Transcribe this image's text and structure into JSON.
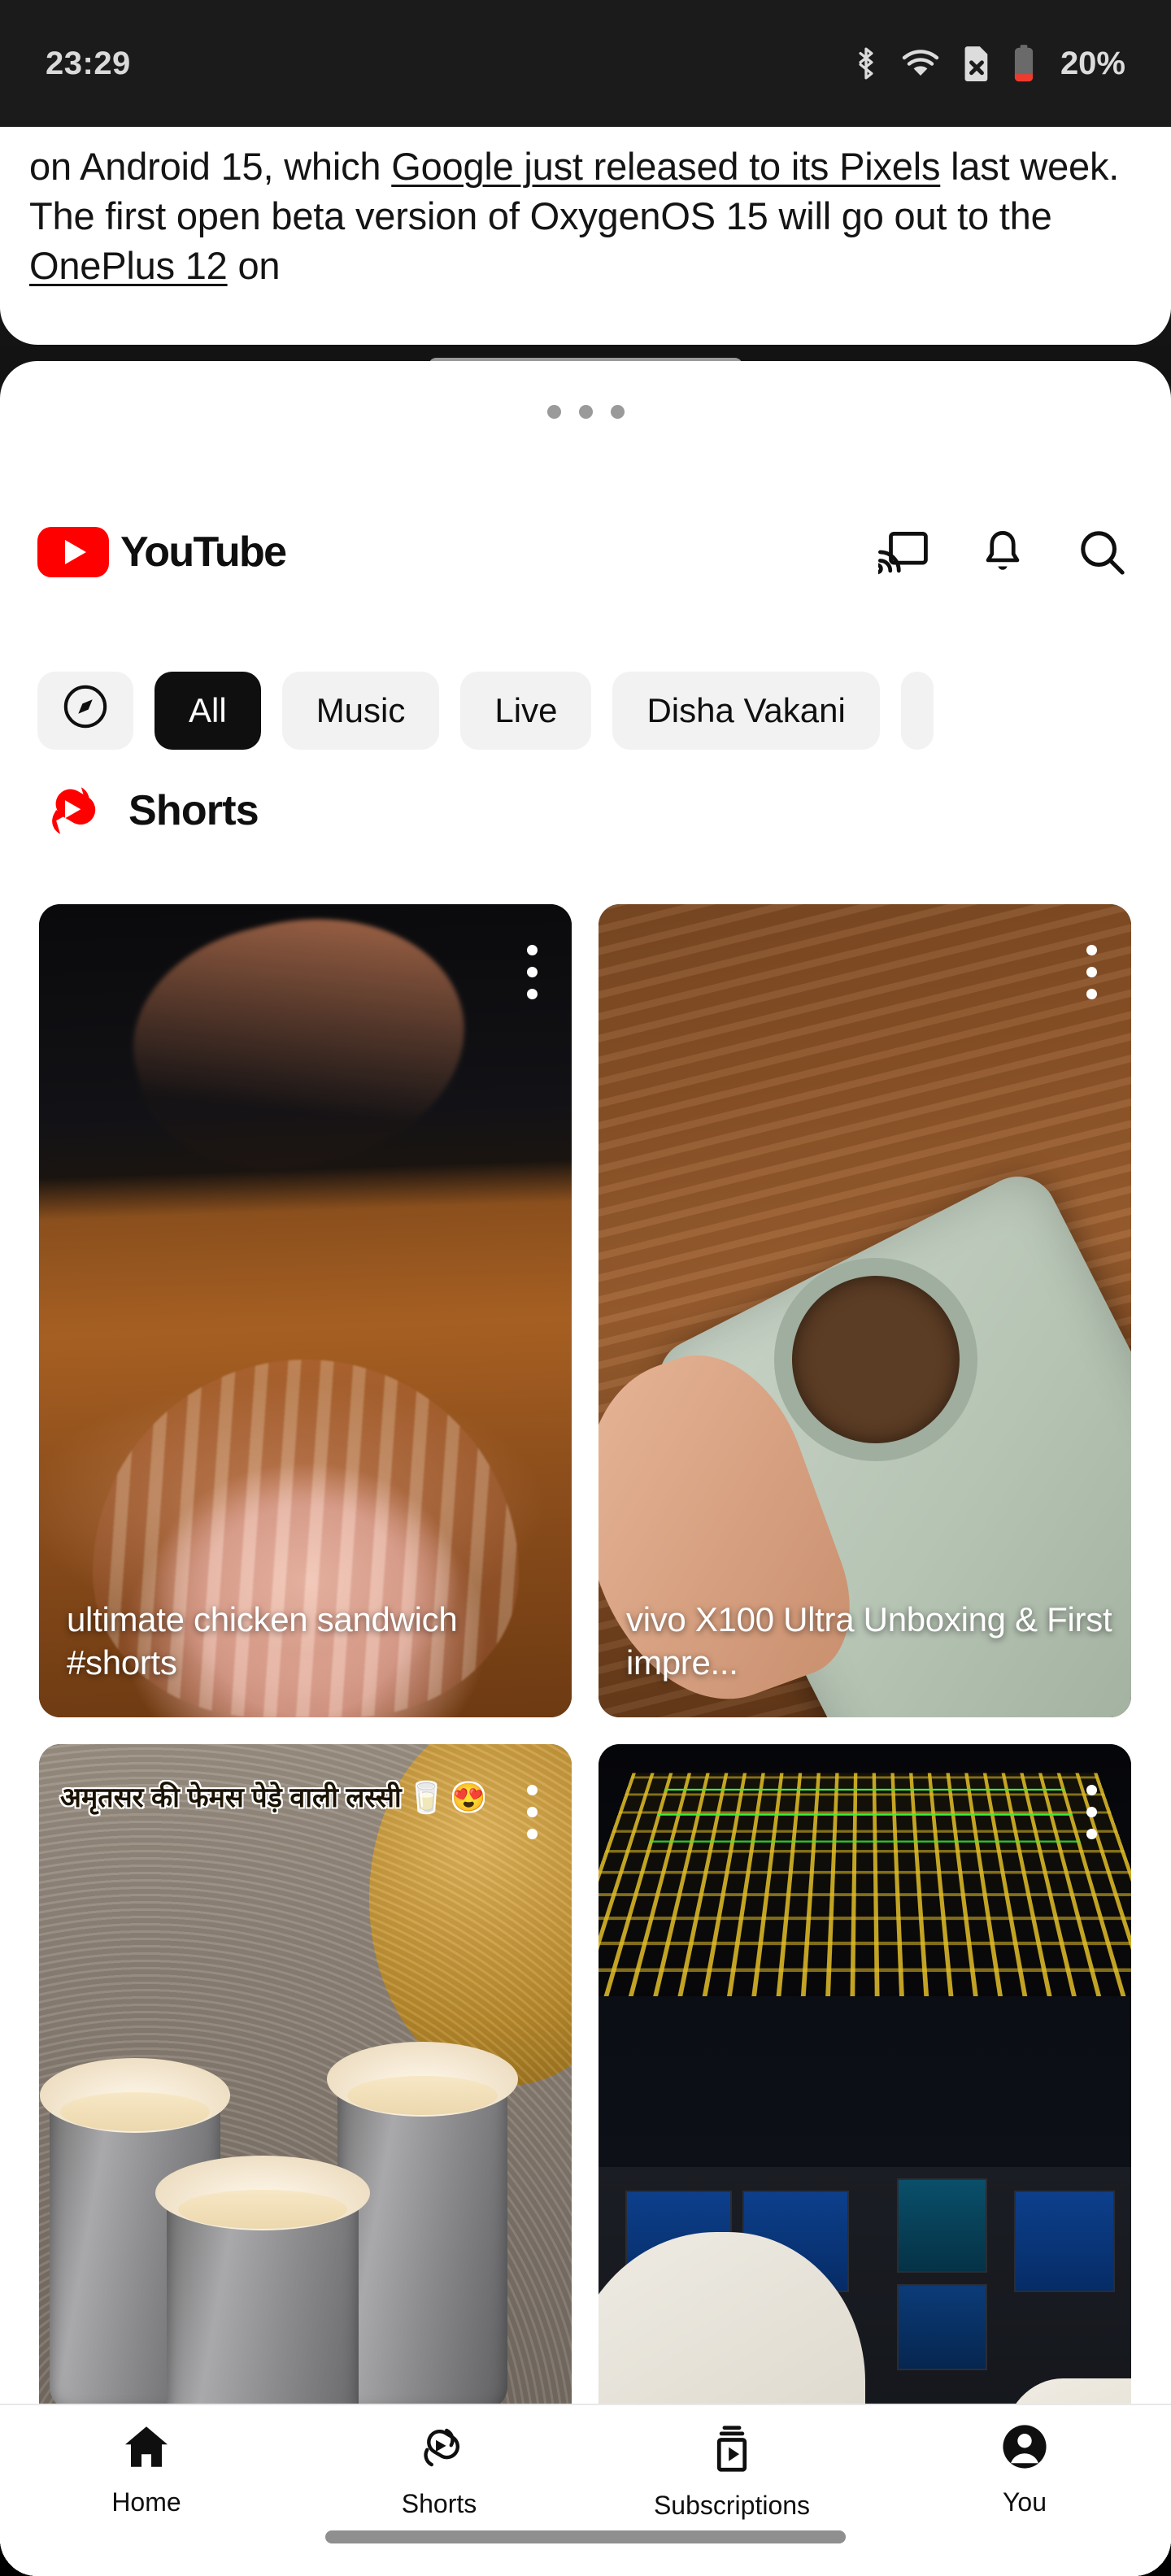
{
  "status_bar": {
    "time": "23:29",
    "battery_percent": "20%",
    "icons": [
      "bluetooth-icon",
      "wifi-icon",
      "no-sim-icon",
      "battery-icon"
    ],
    "battery_color": "#f03a2e",
    "background": "#1b1b1b",
    "text_color": "#dadada"
  },
  "article_app": {
    "paragraph_parts": [
      {
        "text": "on Android 15, which ",
        "underline": false
      },
      {
        "text": "Google just released to its Pixels",
        "underline": true
      },
      {
        "text": " last week. The first open beta version of OxygenOS 15 will go out to the ",
        "underline": false
      },
      {
        "text": "OnePlus 12",
        "underline": true
      },
      {
        "text": " on",
        "underline": false
      }
    ]
  },
  "youtube": {
    "header": {
      "logo_text": "YouTube",
      "logo_color": "#ff0000",
      "actions": [
        {
          "name": "cast-icon",
          "label": "Cast"
        },
        {
          "name": "bell-icon",
          "label": "Notifications"
        },
        {
          "name": "search-icon",
          "label": "Search"
        }
      ]
    },
    "chips": [
      {
        "label": "",
        "icon": "explore-compass-icon",
        "selected": false,
        "type": "icon"
      },
      {
        "label": "All",
        "selected": true,
        "type": "text"
      },
      {
        "label": "Music",
        "selected": false,
        "type": "text"
      },
      {
        "label": "Live",
        "selected": false,
        "type": "text"
      },
      {
        "label": "Disha Vakani",
        "selected": false,
        "type": "text"
      },
      {
        "label": "",
        "selected": false,
        "type": "partial"
      }
    ],
    "shorts_section": {
      "title": "Shorts",
      "logo": "shorts-logo-icon",
      "cards": [
        {
          "title": "ultimate chicken sandwich #shorts",
          "overlay_text": "",
          "thumb": "th-chicken",
          "menu": "more-options-icon"
        },
        {
          "title": "vivo X100 Ultra Unboxing & First impre...",
          "overlay_text": "",
          "thumb": "th-phonecase",
          "menu": "more-options-icon"
        },
        {
          "title": "",
          "overlay_text": "अमृतसर की फेमस पेड़े वाली लस्सी 🥛 😍",
          "thumb": "th-lassi",
          "menu": "more-options-icon"
        },
        {
          "title": "",
          "overlay_text": "",
          "thumb": "th-cockpit",
          "menu": "more-options-icon"
        }
      ]
    },
    "bottom_nav": [
      {
        "label": "Home",
        "icon": "home-icon",
        "active": true
      },
      {
        "label": "Shorts",
        "icon": "shorts-icon",
        "active": false
      },
      {
        "label": "Subscriptions",
        "icon": "subscriptions-icon",
        "active": false
      },
      {
        "label": "You",
        "icon": "account-avatar-icon",
        "active": false
      }
    ]
  }
}
